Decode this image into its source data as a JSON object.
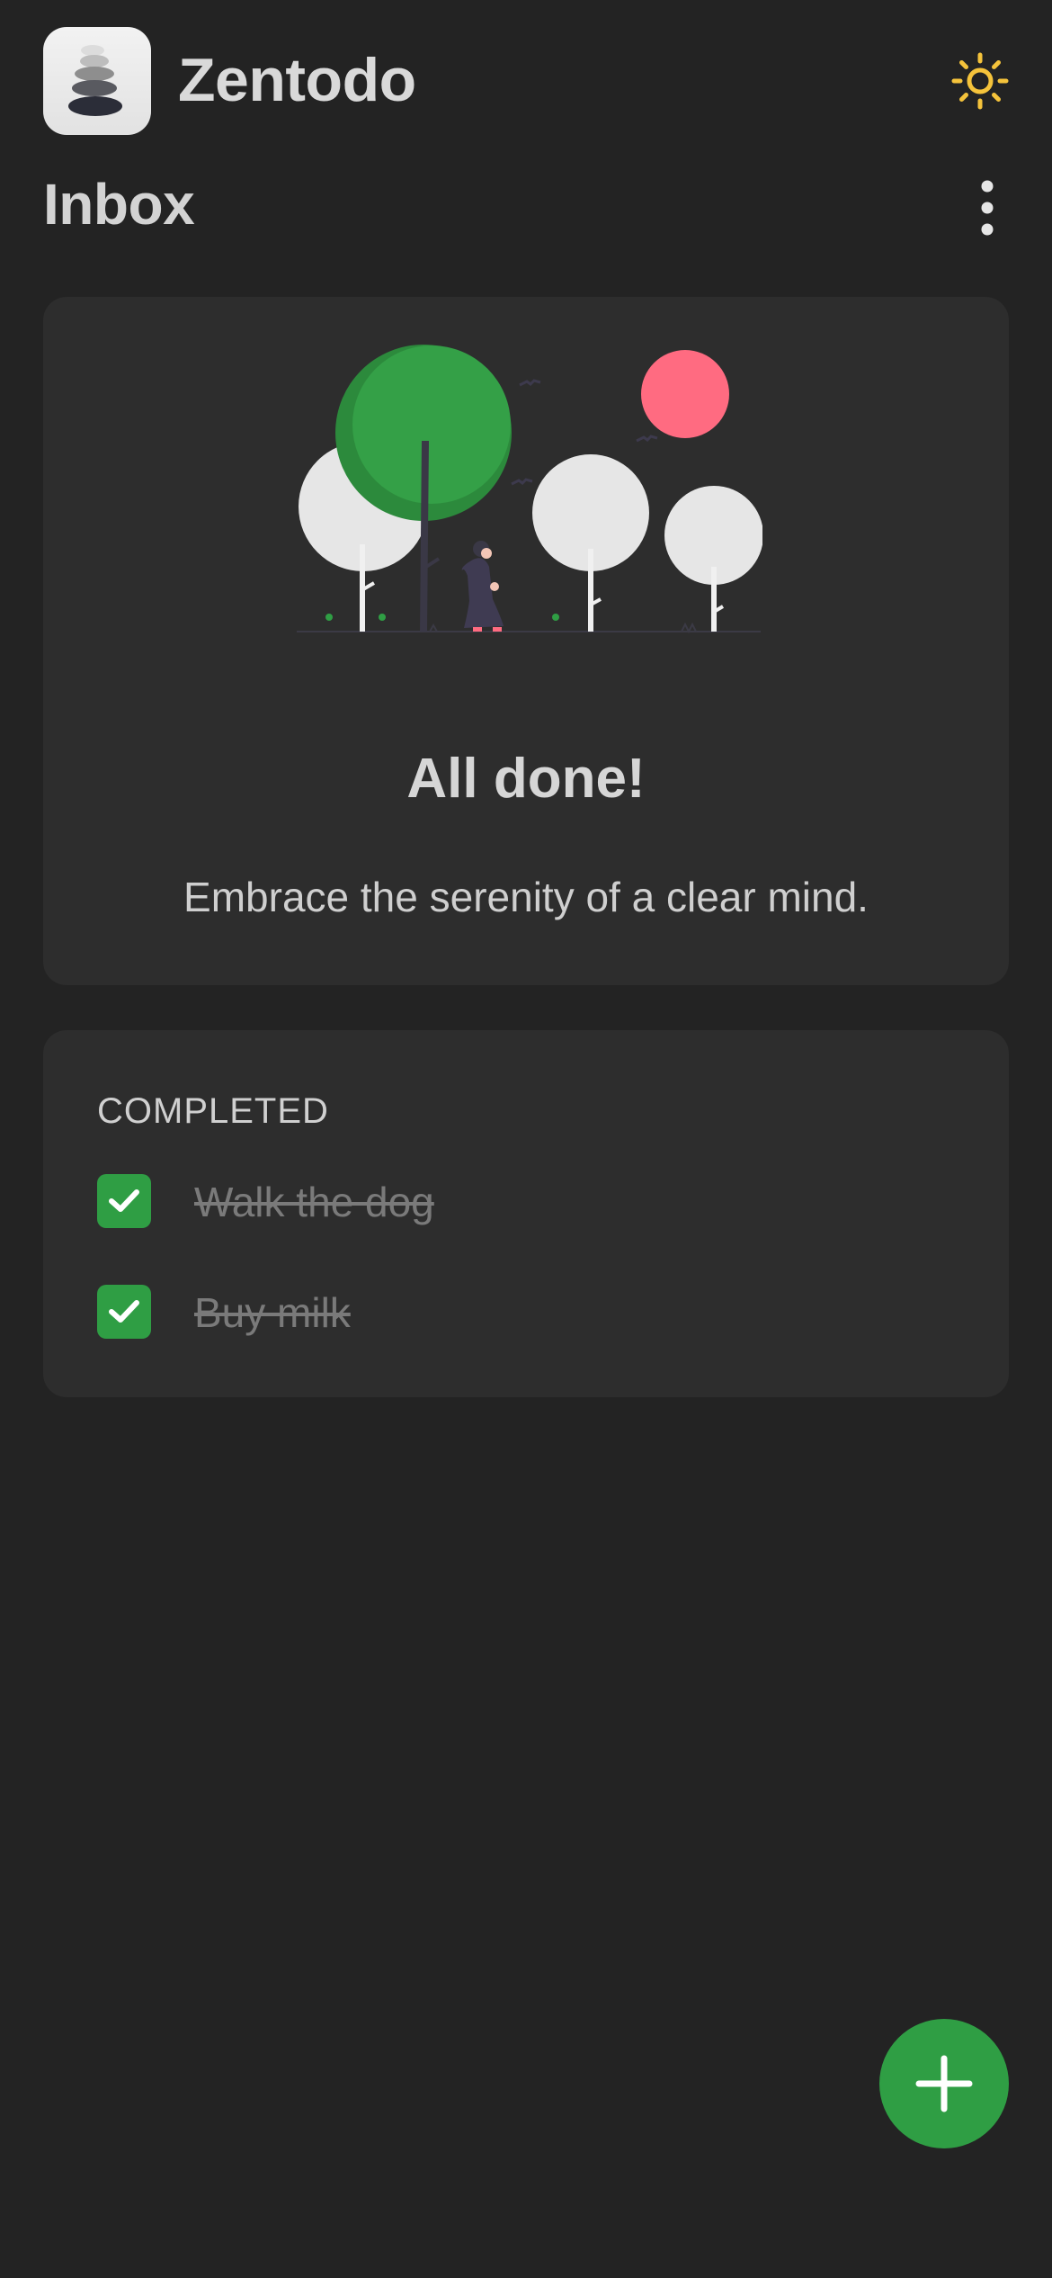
{
  "app": {
    "title": "Zentodo"
  },
  "header": {
    "theme_toggle_icon": "sun-icon",
    "theme_toggle_color": "#f5c33b"
  },
  "page": {
    "title": "Inbox",
    "menu_icon": "more-vertical-icon"
  },
  "empty_state": {
    "title": "All done!",
    "subtitle": "Embrace the serenity of a clear mind."
  },
  "completed": {
    "heading": "COMPLETED",
    "items": [
      {
        "label": "Walk the dog",
        "checked": true
      },
      {
        "label": "Buy milk",
        "checked": true
      }
    ]
  },
  "fab": {
    "icon": "plus-icon"
  },
  "colors": {
    "background": "#232323",
    "card": "#2d2d2d",
    "accent_green": "#2f9e44",
    "sun": "#f5c33b",
    "pink": "#ff6b81"
  }
}
